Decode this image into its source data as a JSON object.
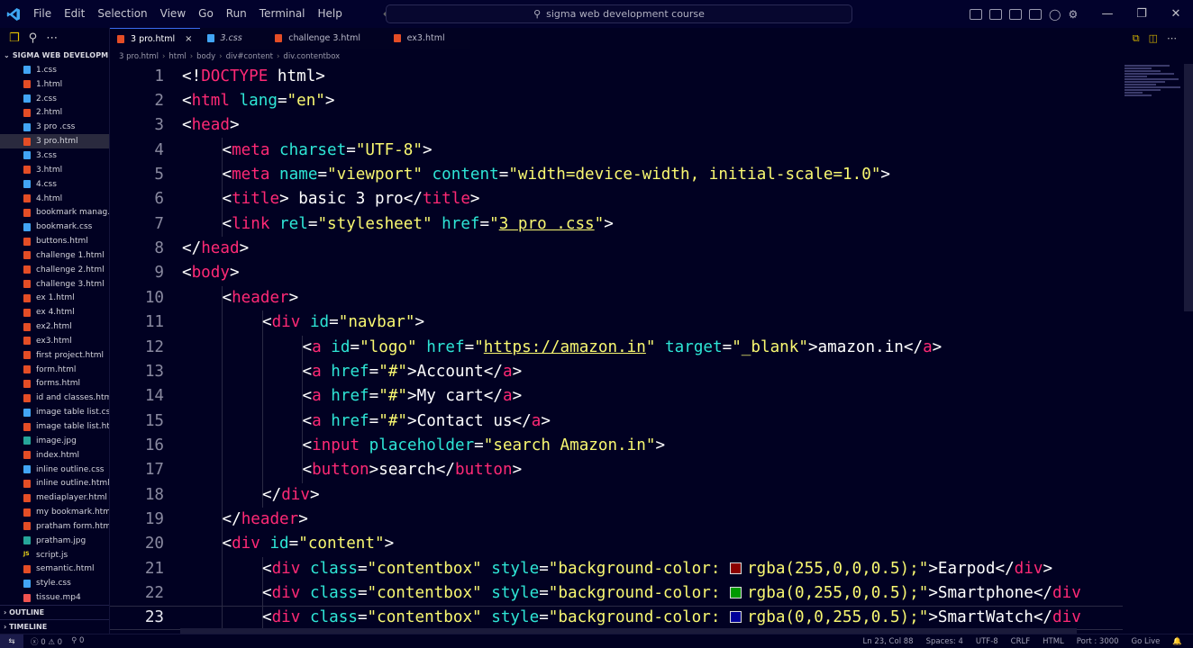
{
  "titlebar": {
    "menu": [
      "File",
      "Edit",
      "Selection",
      "View",
      "Go",
      "Run",
      "Terminal",
      "Help"
    ],
    "search": "sigma web development course"
  },
  "explorer": {
    "folder": "SIGMA WEB DEVELOPMEN...",
    "files": [
      {
        "name": "1.css",
        "type": "css"
      },
      {
        "name": "1.html",
        "type": "html"
      },
      {
        "name": "2.css",
        "type": "css"
      },
      {
        "name": "2.html",
        "type": "html"
      },
      {
        "name": "3 pro .css",
        "type": "css"
      },
      {
        "name": "3 pro.html",
        "type": "html",
        "active": true
      },
      {
        "name": "3.css",
        "type": "css"
      },
      {
        "name": "3.html",
        "type": "html"
      },
      {
        "name": "4.css",
        "type": "css"
      },
      {
        "name": "4.html",
        "type": "html"
      },
      {
        "name": "bookmark manag...",
        "type": "html"
      },
      {
        "name": "bookmark.css",
        "type": "css"
      },
      {
        "name": "buttons.html",
        "type": "html"
      },
      {
        "name": "challenge 1.html",
        "type": "html"
      },
      {
        "name": "challenge 2.html",
        "type": "html"
      },
      {
        "name": "challenge 3.html",
        "type": "html"
      },
      {
        "name": "ex 1.html",
        "type": "html"
      },
      {
        "name": "ex 4.html",
        "type": "html"
      },
      {
        "name": "ex2.html",
        "type": "html"
      },
      {
        "name": "ex3.html",
        "type": "html"
      },
      {
        "name": "first project.html",
        "type": "html"
      },
      {
        "name": "form.html",
        "type": "html"
      },
      {
        "name": "forms.html",
        "type": "html"
      },
      {
        "name": "id and classes.html",
        "type": "html"
      },
      {
        "name": "image table list.css",
        "type": "css"
      },
      {
        "name": "image table list.ht...",
        "type": "html"
      },
      {
        "name": "image.jpg",
        "type": "img"
      },
      {
        "name": "index.html",
        "type": "html"
      },
      {
        "name": "inline outline.css",
        "type": "css"
      },
      {
        "name": "inline outline.html",
        "type": "html"
      },
      {
        "name": "mediaplayer.html",
        "type": "html"
      },
      {
        "name": "my bookmark.html",
        "type": "html"
      },
      {
        "name": "pratham form.html",
        "type": "html"
      },
      {
        "name": "pratham.jpg",
        "type": "img"
      },
      {
        "name": "script.js",
        "type": "js"
      },
      {
        "name": "semantic.html",
        "type": "html"
      },
      {
        "name": "style.css",
        "type": "css"
      },
      {
        "name": "tissue.mp4",
        "type": "vid"
      }
    ],
    "outline": "OUTLINE",
    "timeline": "TIMELINE"
  },
  "tabs": [
    {
      "label": "3 pro.html",
      "type": "html",
      "active": true,
      "close": "×"
    },
    {
      "label": "3.css",
      "type": "css",
      "italic": true
    },
    {
      "label": "challenge 3.html",
      "type": "html"
    },
    {
      "label": "ex3.html",
      "type": "html"
    }
  ],
  "breadcrumbs": [
    "3 pro.html",
    "html",
    "body",
    "div#content",
    "div.contentbox"
  ],
  "code_lines": [
    {
      "n": "1",
      "indent": 0,
      "segs": [
        [
          "p",
          "<!"
        ],
        [
          "t",
          "DOCTYPE"
        ],
        [
          "p",
          " html>"
        ]
      ]
    },
    {
      "n": "2",
      "indent": 0,
      "segs": [
        [
          "p",
          "<"
        ],
        [
          "t",
          "html"
        ],
        [
          "a",
          " lang"
        ],
        [
          "p",
          "="
        ],
        [
          "s",
          "\"en\""
        ],
        [
          "p",
          ">"
        ]
      ]
    },
    {
      "n": "3",
      "indent": 0,
      "segs": [
        [
          "p",
          "<"
        ],
        [
          "t",
          "head"
        ],
        [
          "p",
          ">"
        ]
      ]
    },
    {
      "n": "4",
      "indent": 1,
      "segs": [
        [
          "p",
          "<"
        ],
        [
          "t",
          "meta"
        ],
        [
          "a",
          " charset"
        ],
        [
          "p",
          "="
        ],
        [
          "s",
          "\"UTF-8\""
        ],
        [
          "p",
          ">"
        ]
      ]
    },
    {
      "n": "5",
      "indent": 1,
      "segs": [
        [
          "p",
          "<"
        ],
        [
          "t",
          "meta"
        ],
        [
          "a",
          " name"
        ],
        [
          "p",
          "="
        ],
        [
          "s",
          "\"viewport\""
        ],
        [
          "a",
          " content"
        ],
        [
          "p",
          "="
        ],
        [
          "s",
          "\"width=device-width, initial-scale=1.0\""
        ],
        [
          "p",
          ">"
        ]
      ]
    },
    {
      "n": "6",
      "indent": 1,
      "segs": [
        [
          "p",
          "<"
        ],
        [
          "t",
          "title"
        ],
        [
          "p",
          "> basic 3 pro</"
        ],
        [
          "t",
          "title"
        ],
        [
          "p",
          ">"
        ]
      ]
    },
    {
      "n": "7",
      "indent": 1,
      "segs": [
        [
          "p",
          "<"
        ],
        [
          "t",
          "link"
        ],
        [
          "a",
          " rel"
        ],
        [
          "p",
          "="
        ],
        [
          "s",
          "\"stylesheet\""
        ],
        [
          "a",
          " href"
        ],
        [
          "p",
          "="
        ],
        [
          "s",
          "\""
        ],
        [
          "su",
          "3 pro .css"
        ],
        [
          "s",
          "\""
        ],
        [
          "p",
          ">"
        ]
      ]
    },
    {
      "n": "8",
      "indent": 0,
      "segs": [
        [
          "p",
          "</"
        ],
        [
          "t",
          "head"
        ],
        [
          "p",
          ">"
        ]
      ]
    },
    {
      "n": "9",
      "indent": 0,
      "segs": [
        [
          "p",
          "<"
        ],
        [
          "t",
          "body"
        ],
        [
          "p",
          ">"
        ]
      ]
    },
    {
      "n": "10",
      "indent": 1,
      "segs": [
        [
          "p",
          "<"
        ],
        [
          "t",
          "header"
        ],
        [
          "p",
          ">"
        ]
      ]
    },
    {
      "n": "11",
      "indent": 2,
      "segs": [
        [
          "p",
          "<"
        ],
        [
          "t",
          "div"
        ],
        [
          "a",
          " id"
        ],
        [
          "p",
          "="
        ],
        [
          "s",
          "\"navbar\""
        ],
        [
          "p",
          ">"
        ]
      ]
    },
    {
      "n": "12",
      "indent": 3,
      "segs": [
        [
          "p",
          "<"
        ],
        [
          "t",
          "a"
        ],
        [
          "a",
          " id"
        ],
        [
          "p",
          "="
        ],
        [
          "s",
          "\"logo\""
        ],
        [
          "a",
          " href"
        ],
        [
          "p",
          "="
        ],
        [
          "s",
          "\""
        ],
        [
          "su",
          "https://amazon.in"
        ],
        [
          "s",
          "\""
        ],
        [
          "a",
          " target"
        ],
        [
          "p",
          "="
        ],
        [
          "s",
          "\"_blank\""
        ],
        [
          "p",
          ">amazon.in</"
        ],
        [
          "t",
          "a"
        ],
        [
          "p",
          ">"
        ]
      ]
    },
    {
      "n": "13",
      "indent": 3,
      "segs": [
        [
          "p",
          "<"
        ],
        [
          "t",
          "a"
        ],
        [
          "a",
          " href"
        ],
        [
          "p",
          "="
        ],
        [
          "s",
          "\"#\""
        ],
        [
          "p",
          ">Account</"
        ],
        [
          "t",
          "a"
        ],
        [
          "p",
          ">"
        ]
      ]
    },
    {
      "n": "14",
      "indent": 3,
      "segs": [
        [
          "p",
          "<"
        ],
        [
          "t",
          "a"
        ],
        [
          "a",
          " href"
        ],
        [
          "p",
          "="
        ],
        [
          "s",
          "\"#\""
        ],
        [
          "p",
          ">My cart</"
        ],
        [
          "t",
          "a"
        ],
        [
          "p",
          ">"
        ]
      ]
    },
    {
      "n": "15",
      "indent": 3,
      "segs": [
        [
          "p",
          "<"
        ],
        [
          "t",
          "a"
        ],
        [
          "a",
          " href"
        ],
        [
          "p",
          "="
        ],
        [
          "s",
          "\"#\""
        ],
        [
          "p",
          ">Contact us</"
        ],
        [
          "t",
          "a"
        ],
        [
          "p",
          ">"
        ]
      ]
    },
    {
      "n": "16",
      "indent": 3,
      "segs": [
        [
          "p",
          "<"
        ],
        [
          "t",
          "input"
        ],
        [
          "a",
          " placeholder"
        ],
        [
          "p",
          "="
        ],
        [
          "s",
          "\"search Amazon.in\""
        ],
        [
          "p",
          ">"
        ]
      ]
    },
    {
      "n": "17",
      "indent": 3,
      "segs": [
        [
          "p",
          "<"
        ],
        [
          "t",
          "button"
        ],
        [
          "p",
          ">search</"
        ],
        [
          "t",
          "button"
        ],
        [
          "p",
          ">"
        ]
      ]
    },
    {
      "n": "18",
      "indent": 2,
      "segs": [
        [
          "p",
          "</"
        ],
        [
          "t",
          "div"
        ],
        [
          "p",
          ">"
        ]
      ]
    },
    {
      "n": "19",
      "indent": 1,
      "segs": [
        [
          "p",
          "</"
        ],
        [
          "t",
          "header"
        ],
        [
          "p",
          ">"
        ]
      ]
    },
    {
      "n": "20",
      "indent": 1,
      "segs": [
        [
          "p",
          "<"
        ],
        [
          "t",
          "div"
        ],
        [
          "a",
          " id"
        ],
        [
          "p",
          "="
        ],
        [
          "s",
          "\"content\""
        ],
        [
          "p",
          ">"
        ]
      ]
    },
    {
      "n": "21",
      "indent": 2,
      "segs": [
        [
          "p",
          "<"
        ],
        [
          "t",
          "div"
        ],
        [
          "a",
          " class"
        ],
        [
          "p",
          "="
        ],
        [
          "s",
          "\"contentbox\""
        ],
        [
          "a",
          " style"
        ],
        [
          "p",
          "="
        ],
        [
          "s",
          "\"background-color: "
        ],
        [
          "sw",
          "#8b0000"
        ],
        [
          "s",
          "rgba(255,0,0,0.5);\""
        ],
        [
          "p",
          ">Earpod</"
        ],
        [
          "t",
          "div"
        ],
        [
          "p",
          ">"
        ]
      ]
    },
    {
      "n": "22",
      "indent": 2,
      "segs": [
        [
          "p",
          "<"
        ],
        [
          "t",
          "div"
        ],
        [
          "a",
          " class"
        ],
        [
          "p",
          "="
        ],
        [
          "s",
          "\"contentbox\""
        ],
        [
          "a",
          " style"
        ],
        [
          "p",
          "="
        ],
        [
          "s",
          "\"background-color: "
        ],
        [
          "sw",
          "#009900"
        ],
        [
          "s",
          "rgba(0,255,0,0.5);\""
        ],
        [
          "p",
          ">Smartphone</"
        ],
        [
          "t",
          "div"
        ]
      ]
    },
    {
      "n": "23",
      "indent": 2,
      "current": true,
      "segs": [
        [
          "p",
          "<"
        ],
        [
          "t",
          "div"
        ],
        [
          "a",
          " class"
        ],
        [
          "p",
          "="
        ],
        [
          "s",
          "\"contentbox\""
        ],
        [
          "a",
          " style"
        ],
        [
          "p",
          "="
        ],
        [
          "s",
          "\"background-color: "
        ],
        [
          "sw",
          "#000099"
        ],
        [
          "s",
          "rgba(0,0,255,0.5);\""
        ],
        [
          "p",
          ">SmartWatch</"
        ],
        [
          "t",
          "div"
        ]
      ]
    }
  ],
  "statusbar": {
    "errors": "0",
    "warnings": "0",
    "ports": "0",
    "position": "Ln 23, Col 88",
    "spaces": "Spaces: 4",
    "encoding": "UTF-8",
    "eol": "CRLF",
    "language": "HTML",
    "port": "Port : 3000",
    "golive": "Go Live"
  },
  "colors": {
    "tag": "#ff2975",
    "attribute": "#2ee6d6",
    "string": "#f9f871",
    "background": "#010122"
  }
}
